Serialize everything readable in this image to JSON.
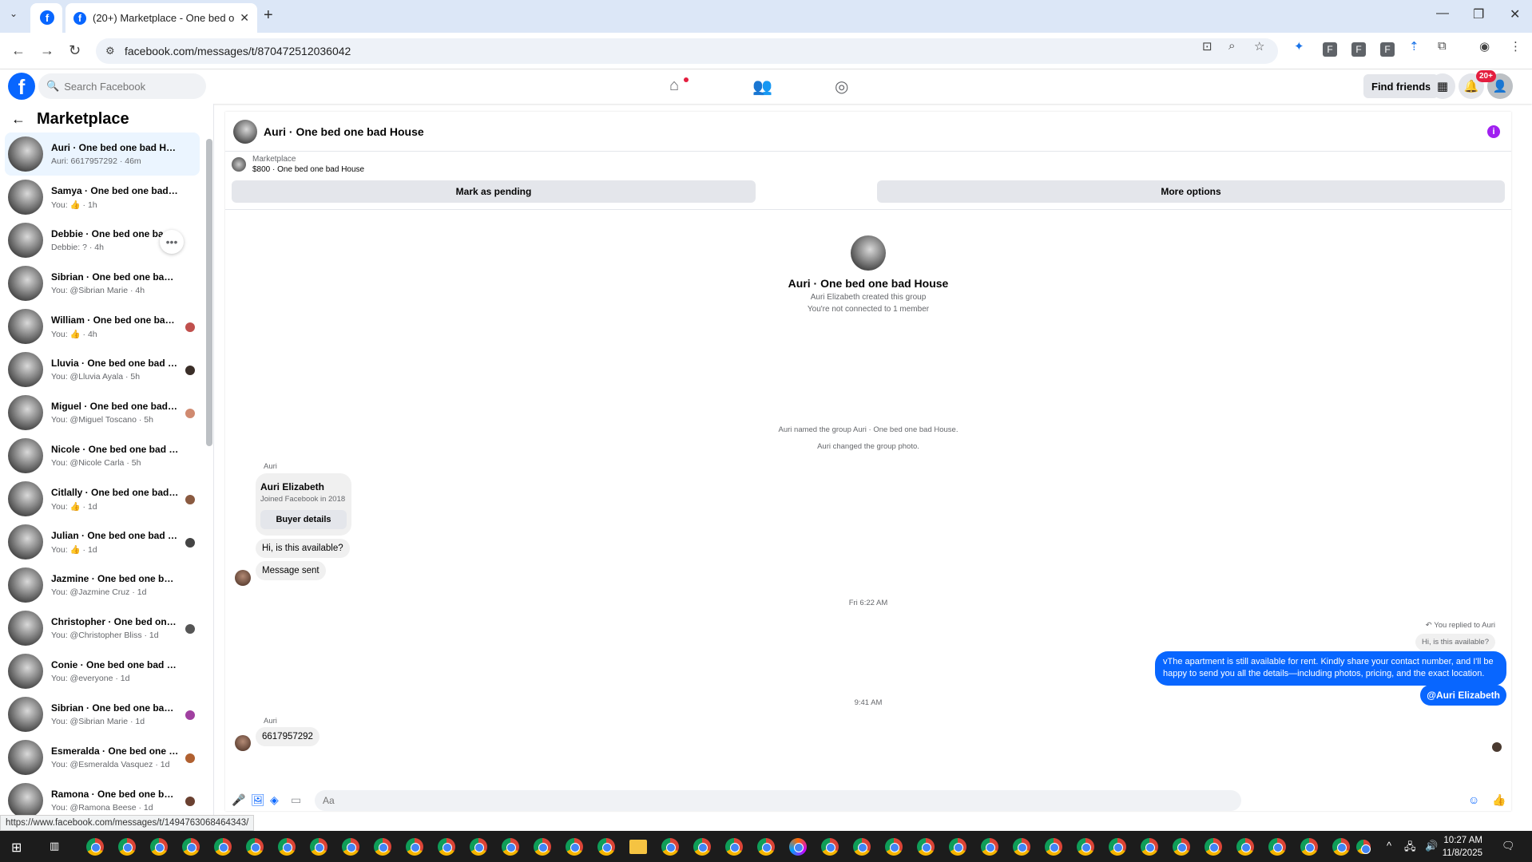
{
  "browser": {
    "tab_title": "(20+) Marketplace - One bed o",
    "url": "facebook.com/messages/t/870472512036042",
    "status_url": "https://www.facebook.com/messages/t/1494763068464343/"
  },
  "fb": {
    "search_placeholder": "Search Facebook",
    "find_friends": "Find friends",
    "notif_count": "20+"
  },
  "sidebar": {
    "title": "Marketplace",
    "conversations": [
      {
        "name": "Auri · One bed one bad House",
        "sub": "Auri: 6617957292 · 46m"
      },
      {
        "name": "Samya · One bed one bad House",
        "sub": "You: 👍 · 1h"
      },
      {
        "name": "Debbie · One bed one bad House",
        "sub": "Debbie: ? · 4h"
      },
      {
        "name": "Sibrian · One bed one bad House",
        "sub": "You: @Sibrian Marie · 4h"
      },
      {
        "name": "William · One bed one bad H...",
        "sub": "You: 👍 · 4h"
      },
      {
        "name": "Lluvia · One bed one bad Ho...",
        "sub": "You: @Lluvia Ayala · 5h"
      },
      {
        "name": "Miguel · One bed one bad H...",
        "sub": "You: @Miguel Toscano · 5h"
      },
      {
        "name": "Nicole · One bed one bad House",
        "sub": "You: @Nicole Carla · 5h"
      },
      {
        "name": "Citlally · One bed one bad Ho...",
        "sub": "You: 👍 · 1d"
      },
      {
        "name": "Julian · One bed one bad Ho...",
        "sub": "You: 👍 · 1d"
      },
      {
        "name": "Jazmine · One bed one bad Ho...",
        "sub": "You: @Jazmine Cruz · 1d"
      },
      {
        "name": "Christopher · One bed one b...",
        "sub": "You: @Christopher Bliss · 1d"
      },
      {
        "name": "Conie · One bed one bad House",
        "sub": "You: @everyone · 1d"
      },
      {
        "name": "Sibrian · One bed one bad H...",
        "sub": "You: @Sibrian Marie · 1d"
      },
      {
        "name": "Esmeralda · One bed one bad...",
        "sub": "You: @Esmeralda Vasquez · 1d"
      },
      {
        "name": "Ramona · One bed one bad ...",
        "sub": "You: @Ramona Beese · 1d"
      }
    ]
  },
  "chat": {
    "title": "Auri · One bed one bad House",
    "listing_source": "Marketplace",
    "listing_title": "$800 · One bed one bad House",
    "mark_pending": "Mark as pending",
    "more_options": "More options",
    "group_title": "Auri · One bed one bad House",
    "created_by": "Auri Elizabeth created this group",
    "not_connected": "You're not connected to 1 member",
    "event_named": "Auri named the group Auri · One bed one bad House.",
    "event_photo": "Auri changed the group photo.",
    "sender": "Auri",
    "card_name": "Auri Elizabeth",
    "card_sub": "Joined Facebook in 2018",
    "buyer_details": "Buyer details",
    "msg_available": "Hi, is this available?",
    "msg_sent": "Message sent",
    "time1": "Fri 6:22 AM",
    "replied_to": "You replied to Auri",
    "reply_quote": "Hi, is this available?",
    "my_message": "vThe apartment is still available for rent. Kindly share your contact number, and I'll be happy to send you all the details—including photos, pricing, and the exact location.",
    "mention": "@Auri Elizabeth",
    "time2": "9:41 AM",
    "sender2": "Auri",
    "msg_number": "6617957292",
    "composer_placeholder": "Aa"
  },
  "taskbar": {
    "time": "10:27 AM",
    "date": "11/8/2025"
  }
}
